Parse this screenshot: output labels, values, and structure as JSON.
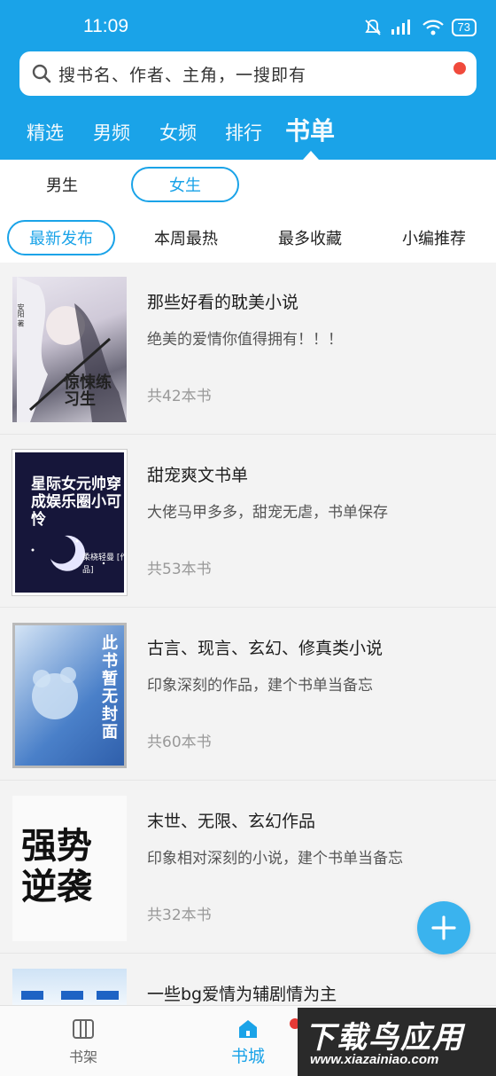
{
  "status_bar": {
    "time": "11:09",
    "battery": "73"
  },
  "search": {
    "placeholder": "搜书名、作者、主角，一搜即有"
  },
  "nav_tabs": [
    {
      "label": "精选"
    },
    {
      "label": "男频"
    },
    {
      "label": "女频"
    },
    {
      "label": "排行"
    },
    {
      "label": "书单",
      "active": true
    }
  ],
  "gender_tabs": [
    {
      "label": "男生"
    },
    {
      "label": "女生",
      "active": true
    }
  ],
  "sort_tabs": [
    {
      "label": "最新发布",
      "active": true
    },
    {
      "label": "本周最热"
    },
    {
      "label": "最多收藏"
    },
    {
      "label": "小编推荐"
    }
  ],
  "booklists": [
    {
      "title": "那些好看的耽美小说",
      "desc": "绝美的爱情你值得拥有！！！",
      "count": "共42本书",
      "cover_title": "惊悚练习生",
      "cover_author": "安阳 著"
    },
    {
      "title": "甜宠爽文书单",
      "desc": "大佬马甲多多，甜宠无虐，书单保存",
      "count": "共53本书",
      "cover_title": "星际女元帅穿成娱乐圈小可怜",
      "cover_author": "柔桡轻曼 [作品]"
    },
    {
      "title": "古言、现言、玄幻、修真类小说",
      "desc": "印象深刻的作品，建个书单当备忘",
      "count": "共60本书",
      "cover_title": "此书暂无封面"
    },
    {
      "title": "末世、无限、玄幻作品",
      "desc": "印象相对深刻的小说，建个书单当备忘",
      "count": "共32本书",
      "cover_title": "强势逆袭"
    },
    {
      "title": "一些bg爱情为辅剧情为主",
      "desc": "",
      "count": ""
    }
  ],
  "bottom_nav": [
    {
      "label": "书架"
    },
    {
      "label": "书城",
      "active": true
    }
  ],
  "watermark": {
    "title": "下载鸟应用",
    "url": "www.xiazainiao.com"
  },
  "colors": {
    "primary": "#1aa3e8",
    "fab": "#3ab3ee",
    "badge": "#f04a3c"
  }
}
